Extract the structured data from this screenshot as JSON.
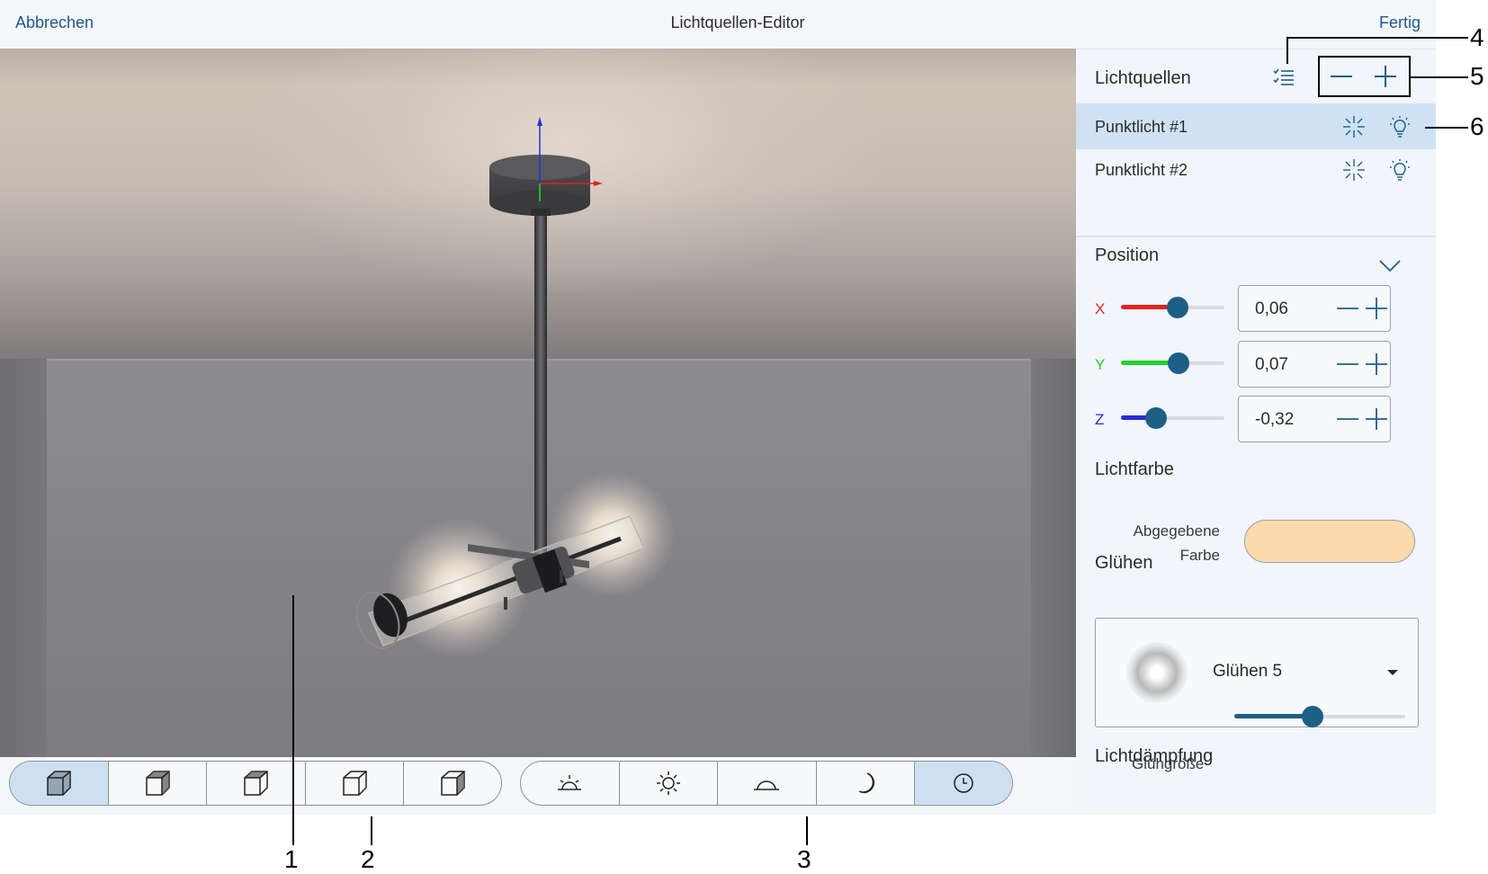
{
  "topbar": {
    "cancel": "Abbrechen",
    "title": "Lichtquellen-Editor",
    "done": "Fertig"
  },
  "viewport": {
    "toolbar": {
      "view_buttons": [
        {
          "icon": "cube-perspective-icon",
          "active": true
        },
        {
          "icon": "cube-front-icon",
          "active": false
        },
        {
          "icon": "cube-side-icon",
          "active": false
        },
        {
          "icon": "cube-top-icon",
          "active": false
        },
        {
          "icon": "cube-back-icon",
          "active": false
        }
      ],
      "lighting_buttons": [
        {
          "icon": "sunrise-icon",
          "active": false
        },
        {
          "icon": "sun-icon",
          "active": false
        },
        {
          "icon": "dusk-icon",
          "active": false
        },
        {
          "icon": "moon-icon",
          "active": false
        },
        {
          "icon": "clock-icon",
          "active": true
        }
      ]
    }
  },
  "panel": {
    "lights_title": "Lichtquellen",
    "lights": [
      {
        "name": "Punktlicht #1",
        "selected": true
      },
      {
        "name": "Punktlicht #2",
        "selected": false
      }
    ],
    "position_title": "Position",
    "axes": [
      {
        "label": "X",
        "value": "0,06",
        "color": "#e32222",
        "fill": 0.55
      },
      {
        "label": "Y",
        "value": "0,07",
        "color": "#22d12a",
        "fill": 0.56
      },
      {
        "label": "Z",
        "value": "-0,32",
        "color": "#2a2ad6",
        "fill": 0.34
      }
    ],
    "light_color_title": "Lichtfarbe",
    "emitted_color_label": "Abgegebene Farbe",
    "emitted_color": "#fdd9ae",
    "glow_title": "Glühen",
    "glow_value": "Glühen 5",
    "glow_size_label": "Glühgröße",
    "glow_size": 0.46,
    "attenuation_title": "Lichtdämpfung"
  },
  "accent_color": "#1e5f86",
  "callouts": [
    "1",
    "2",
    "3",
    "4",
    "5",
    "6"
  ]
}
